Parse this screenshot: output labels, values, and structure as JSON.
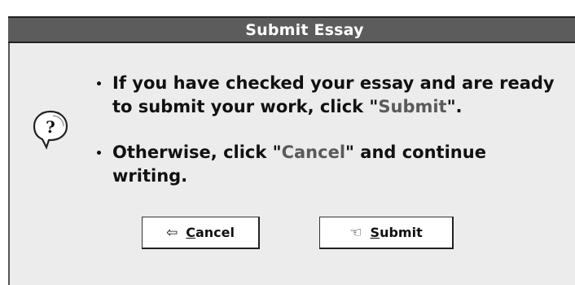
{
  "dialog": {
    "title": "Submit Essay",
    "icon": "question-balloon-icon",
    "bullets": [
      {
        "pre": "If you have checked your essay and are ready to submit your work, click \"",
        "keyword": "Submit",
        "post": "\"."
      },
      {
        "pre": "Otherwise, click \"",
        "keyword": "Cancel",
        "post": "\" and continue writing."
      }
    ],
    "buttons": {
      "cancel": {
        "icon": "arrow-left-icon",
        "icon_glyph": "⇦",
        "mnemonic": "C",
        "rest": "ancel"
      },
      "submit": {
        "icon": "hand-pointer-icon",
        "icon_glyph": "☜",
        "mnemonic": "S",
        "rest": "ubmit"
      }
    }
  },
  "colors": {
    "title_bar": "#5c5c5c",
    "dialog_bg": "#ececec",
    "keyword": "#5a5a5a"
  }
}
